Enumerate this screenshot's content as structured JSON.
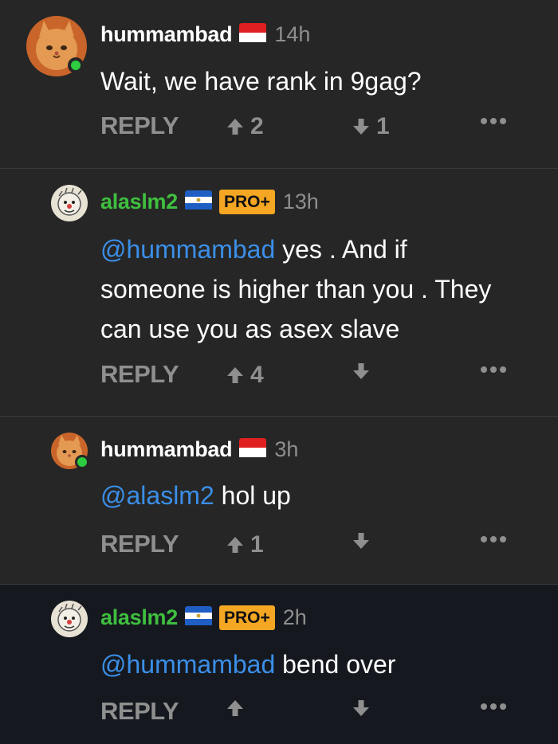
{
  "comments": [
    {
      "username": "hummambad",
      "flag": "indonesia-flag",
      "time": "14h",
      "text": "Wait, we have rank in 9gag?",
      "reply_label": "REPLY",
      "upvotes": "2",
      "downvotes": "1",
      "online": true
    },
    {
      "username": "alaslm2",
      "flag": "el-salvador-flag",
      "badge": "PRO+",
      "time": "13h",
      "mention": "@hummambad",
      "text_lines": [
        " yes . And if",
        "someone is higher than you . They",
        "can use you as asex slave"
      ],
      "reply_label": "REPLY",
      "upvotes": "4",
      "downvotes": ""
    },
    {
      "username": "hummambad",
      "flag": "indonesia-flag",
      "time": "3h",
      "mention": "@alaslm2",
      "text": " hol up",
      "reply_label": "REPLY",
      "upvotes": "1",
      "downvotes": "",
      "online": true
    },
    {
      "username": "alaslm2",
      "flag": "el-salvador-flag",
      "badge": "PRO+",
      "time": "2h",
      "mention": "@hummambad",
      "text": " bend over",
      "reply_label": "REPLY",
      "upvotes": "",
      "downvotes": "",
      "highlighted": true
    }
  ],
  "colors": {
    "background": "#262626",
    "highlight_background": "#15191f",
    "mention": "#3b8fe8",
    "pro_username": "#3fbf3f",
    "pro_badge": "#f5a623",
    "muted": "#8f8f8f",
    "online": "#2ecc40"
  },
  "icons": {
    "upvote": "arrow-up-icon",
    "downvote": "arrow-down-icon",
    "more": "more-dots-icon"
  }
}
